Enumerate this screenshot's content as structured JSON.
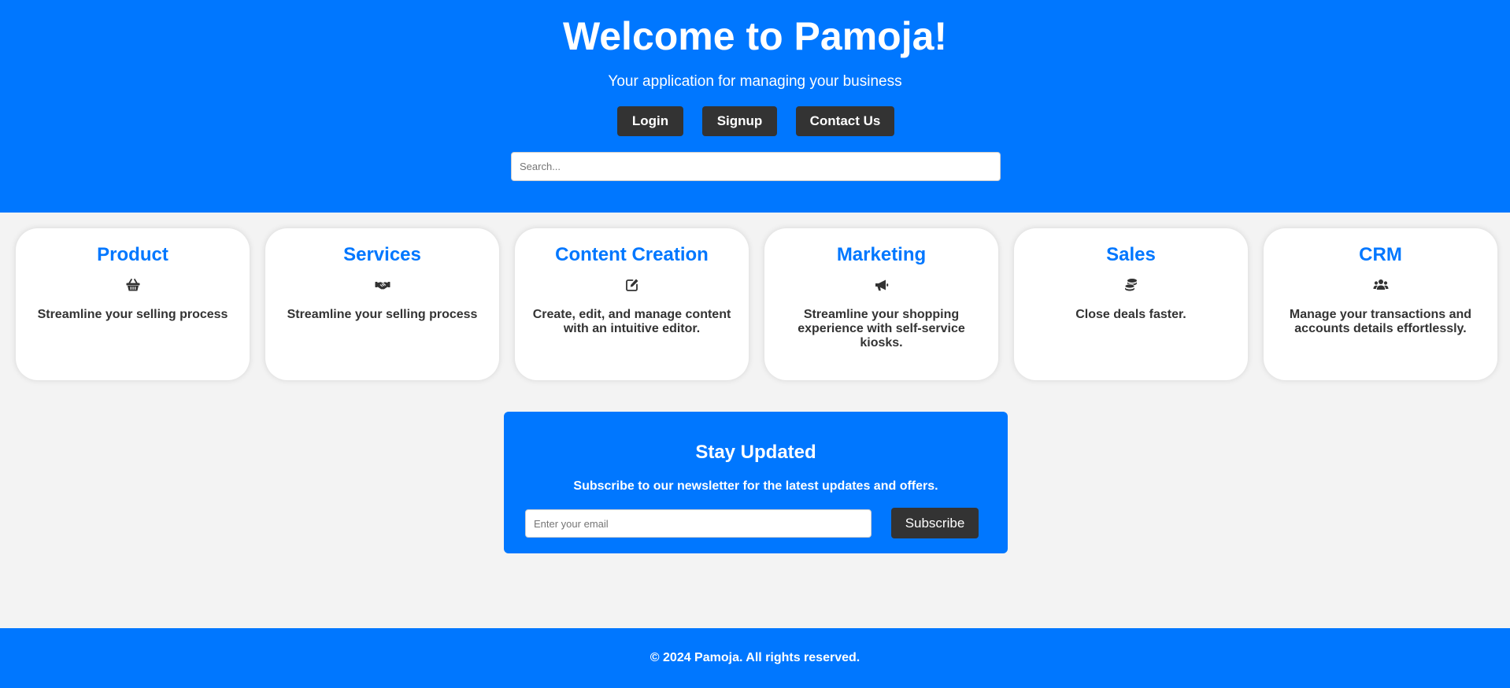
{
  "hero": {
    "title": "Welcome to Pamoja!",
    "subtitle": "Your application for managing your business",
    "buttons": {
      "login": "Login",
      "signup": "Signup",
      "contact": "Contact Us"
    },
    "search_placeholder": "Search..."
  },
  "cards": [
    {
      "title": "Product",
      "icon": "shopping-basket-icon",
      "text": "Streamline your selling process"
    },
    {
      "title": "Services",
      "icon": "handshake-icon",
      "text": "Streamline your selling process"
    },
    {
      "title": "Content Creation",
      "icon": "edit-icon",
      "text": "Create, edit, and manage content with an intuitive editor."
    },
    {
      "title": "Marketing",
      "icon": "megaphone-icon",
      "text": "Streamline your shopping experience with self-service kiosks."
    },
    {
      "title": "Sales",
      "icon": "coins-icon",
      "text": "Close deals faster."
    },
    {
      "title": "CRM",
      "icon": "users-icon",
      "text": "Manage your transactions and accounts details effortlessly."
    }
  ],
  "newsletter": {
    "title": "Stay Updated",
    "subtitle": "Subscribe to our newsletter for the latest updates and offers.",
    "email_placeholder": "Enter your email",
    "button": "Subscribe"
  },
  "footer": {
    "text": "© 2024 Pamoja. All rights reserved."
  },
  "colors": {
    "primary": "#0077ff",
    "dark": "#333333",
    "background": "#f3f3f3"
  }
}
